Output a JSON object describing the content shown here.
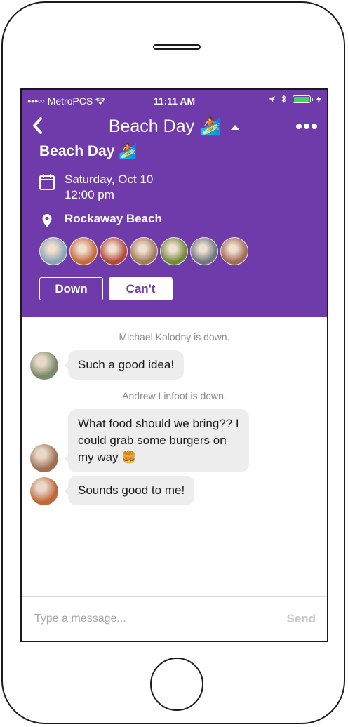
{
  "status_bar": {
    "carrier": "MetroPCS",
    "time": "11:11 AM"
  },
  "nav": {
    "back_icon": "chevron-left-icon",
    "title": "Beach Day 🏄",
    "more_icon": "ellipsis-icon"
  },
  "event": {
    "title": "Beach Day 🏄",
    "date": "Saturday, Oct 10",
    "time": "12:00 pm",
    "location": "Rockaway Beach",
    "attendee_colors": [
      "#8aa3b5",
      "#c46a3c",
      "#b0473a",
      "#9e7a5a",
      "#6f8a3a",
      "#6d7680",
      "#a06a55"
    ],
    "down_label": "Down",
    "cant_label": "Can't"
  },
  "chat": {
    "items": [
      {
        "type": "system",
        "text": "Michael Kolodny is down."
      },
      {
        "type": "message",
        "text": "Such a good idea!",
        "avatar_color": "#7a8a6a"
      },
      {
        "type": "system",
        "text": "Andrew Linfoot is down."
      },
      {
        "type": "message",
        "text": "What food should we bring?? I could grab some burgers on my way 🍔",
        "avatar_color": "#a07055"
      },
      {
        "type": "message",
        "text": "Sounds good to me!",
        "avatar_color": "#c0683a"
      }
    ]
  },
  "composer": {
    "placeholder": "Type a message...",
    "send_label": "Send"
  },
  "colors": {
    "brand": "#6f3aa9",
    "bubble": "#ededed",
    "battery": "#3cd35f"
  }
}
